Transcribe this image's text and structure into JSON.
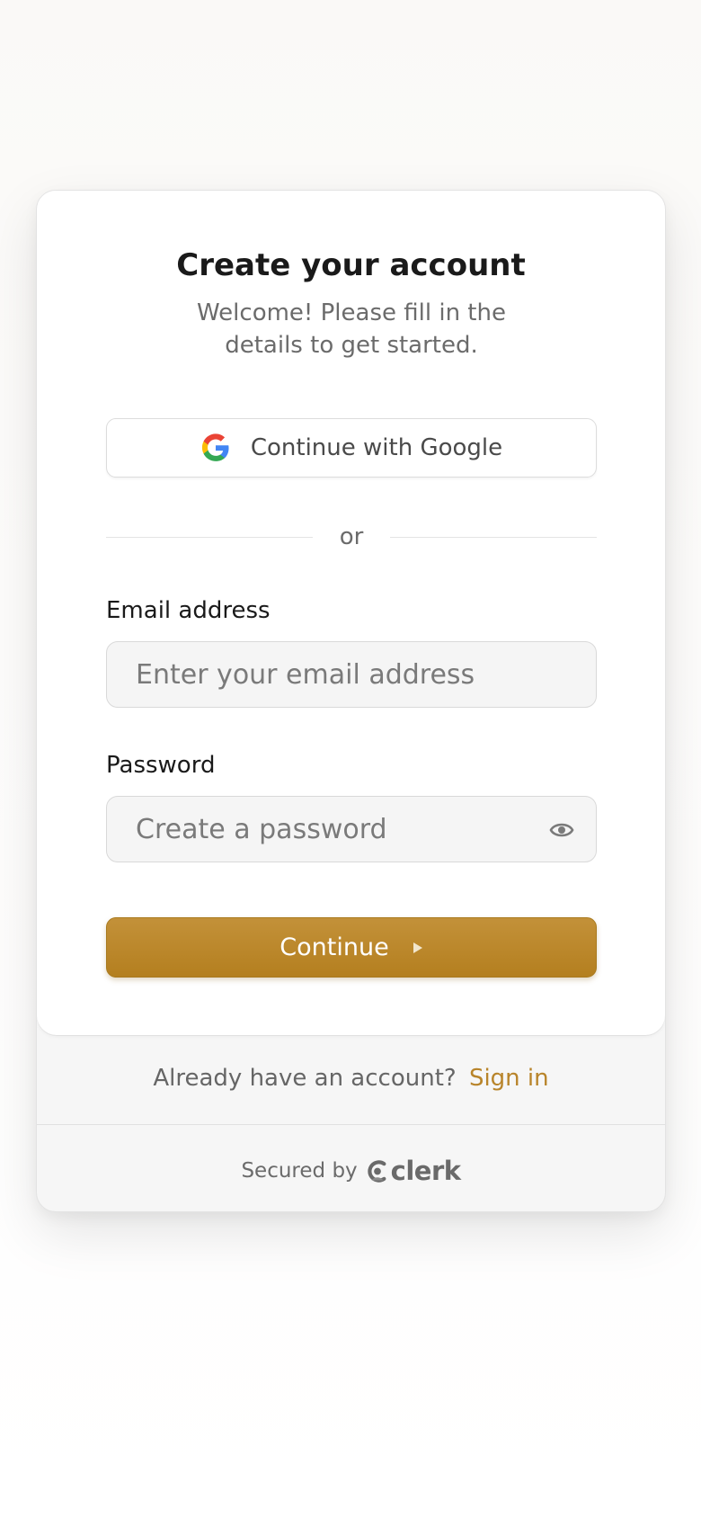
{
  "header": {
    "title": "Create your account",
    "subtitle": "Welcome! Please fill in the details to get started."
  },
  "social": {
    "google_label": "Continue with Google",
    "google_icon": "google-g-icon"
  },
  "divider_text": "or",
  "form": {
    "email_label": "Email address",
    "email_placeholder": "Enter your email address",
    "password_label": "Password",
    "password_placeholder": "Create a password",
    "password_toggle_icon": "eye-icon",
    "submit_label": "Continue"
  },
  "footer": {
    "prompt": "Already have an account?",
    "signin_link": "Sign in",
    "secured_by": "Secured by",
    "brand": "clerk"
  },
  "colors": {
    "accent": "#b8842a",
    "button_top": "#c39139",
    "button_bottom": "#b47f1f"
  }
}
